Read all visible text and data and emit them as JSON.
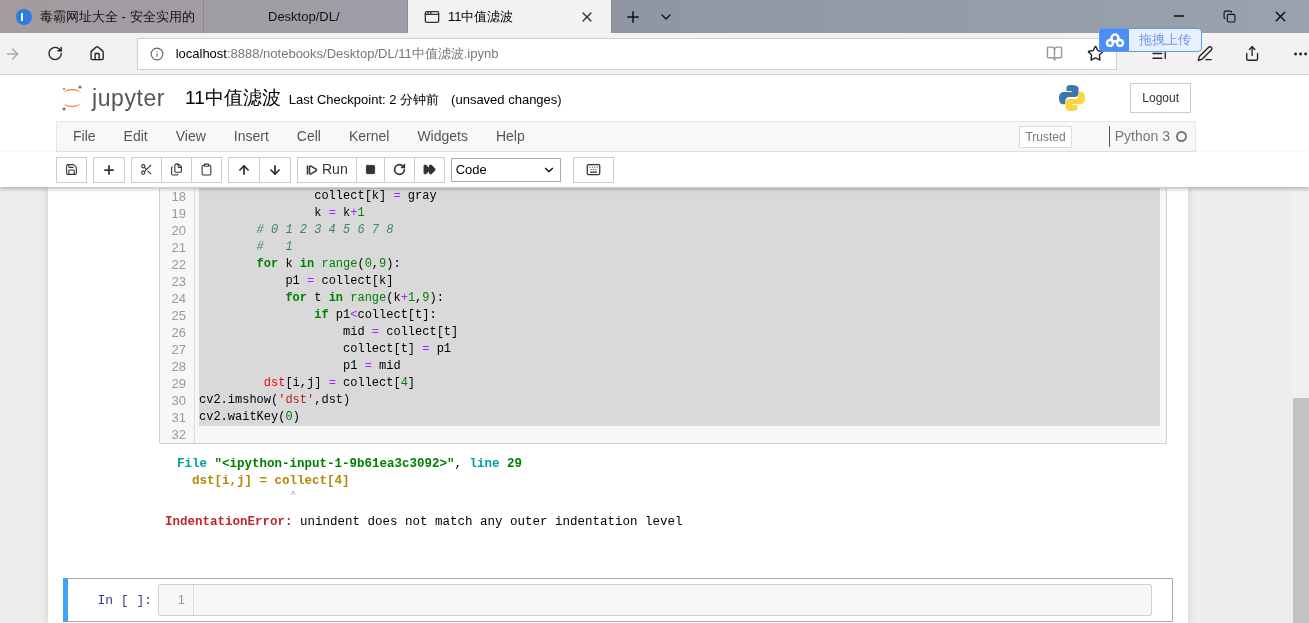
{
  "browser": {
    "tabs": [
      {
        "title": "毒霸网址大全 - 安全实用的",
        "kind": "site",
        "selected": false
      },
      {
        "title": "Desktop/DL/",
        "kind": "blank",
        "selected": false
      },
      {
        "title": "11中值滤波",
        "kind": "page",
        "selected": true
      }
    ],
    "address": {
      "host": "localhost",
      "path": ":8888/notebooks/Desktop/DL/11中值滤波.ipynb"
    },
    "upload_popup": "拖拽上传"
  },
  "header": {
    "logo": "jupyter",
    "notebook_name": "11中值滤波",
    "checkpoint": "Last Checkpoint: 2 分钟前",
    "status": "(unsaved changes)",
    "logout": "Logout"
  },
  "menu": [
    "File",
    "Edit",
    "View",
    "Insert",
    "Cell",
    "Kernel",
    "Widgets",
    "Help"
  ],
  "trusted": "Trusted",
  "kernel": {
    "name": "Python 3",
    "busy": false
  },
  "toolbar": {
    "run": "Run",
    "cell_type": "Code"
  },
  "cells": [
    {
      "selected": false,
      "lines": [
        {
          "n": "18",
          "tokens": [
            {
              "kind": "plain",
              "t": "                collect[k] "
            },
            {
              "kind": "op",
              "t": "="
            },
            {
              "kind": "plain",
              "t": " gray"
            }
          ]
        },
        {
          "n": "19",
          "tokens": [
            {
              "kind": "plain",
              "t": "                k "
            },
            {
              "kind": "op",
              "t": "="
            },
            {
              "kind": "plain",
              "t": " k"
            },
            {
              "kind": "op",
              "t": "+"
            },
            {
              "kind": "num",
              "t": "1"
            }
          ]
        },
        {
          "n": "20",
          "tokens": [
            {
              "kind": "comment",
              "t": "        # 0 1 2 3 4 5 6 7 8"
            }
          ]
        },
        {
          "n": "21",
          "tokens": [
            {
              "kind": "comment",
              "t": "        #   1"
            }
          ]
        },
        {
          "n": "22",
          "tokens": [
            {
              "kind": "kw",
              "t": "        for"
            },
            {
              "kind": "plain",
              "t": " k "
            },
            {
              "kind": "kw",
              "t": "in"
            },
            {
              "kind": "builtin",
              "t": " range"
            },
            {
              "kind": "plain",
              "t": "("
            },
            {
              "kind": "num",
              "t": "0"
            },
            {
              "kind": "plain",
              "t": ","
            },
            {
              "kind": "num",
              "t": "9"
            },
            {
              "kind": "plain",
              "t": "):"
            }
          ]
        },
        {
          "n": "23",
          "tokens": [
            {
              "kind": "plain",
              "t": "            p1 "
            },
            {
              "kind": "op",
              "t": "="
            },
            {
              "kind": "plain",
              "t": " collect[k]"
            }
          ]
        },
        {
          "n": "24",
          "tokens": [
            {
              "kind": "kw",
              "t": "            for"
            },
            {
              "kind": "plain",
              "t": " t "
            },
            {
              "kind": "kw",
              "t": "in"
            },
            {
              "kind": "builtin",
              "t": " range"
            },
            {
              "kind": "plain",
              "t": "(k"
            },
            {
              "kind": "op",
              "t": "+"
            },
            {
              "kind": "num",
              "t": "1"
            },
            {
              "kind": "plain",
              "t": ","
            },
            {
              "kind": "num",
              "t": "9"
            },
            {
              "kind": "plain",
              "t": "):"
            }
          ]
        },
        {
          "n": "25",
          "tokens": [
            {
              "kind": "kw",
              "t": "                if"
            },
            {
              "kind": "plain",
              "t": " p1"
            },
            {
              "kind": "op",
              "t": "<"
            },
            {
              "kind": "plain",
              "t": "collect[t]:"
            }
          ]
        },
        {
          "n": "26",
          "tokens": [
            {
              "kind": "plain",
              "t": "                    mid "
            },
            {
              "kind": "op",
              "t": "="
            },
            {
              "kind": "plain",
              "t": " collect[t]"
            }
          ]
        },
        {
          "n": "27",
          "tokens": [
            {
              "kind": "plain",
              "t": "                    collect[t] "
            },
            {
              "kind": "op",
              "t": "="
            },
            {
              "kind": "plain",
              "t": " p1"
            }
          ]
        },
        {
          "n": "28",
          "tokens": [
            {
              "kind": "plain",
              "t": "                    p1 "
            },
            {
              "kind": "op",
              "t": "="
            },
            {
              "kind": "plain",
              "t": " mid"
            }
          ]
        },
        {
          "n": "29",
          "tokens": [
            {
              "kind": "error",
              "t": "         dst"
            },
            {
              "kind": "plain",
              "t": "[i,j] "
            },
            {
              "kind": "op",
              "t": "="
            },
            {
              "kind": "plain",
              "t": " collect["
            },
            {
              "kind": "num",
              "t": "4"
            },
            {
              "kind": "plain",
              "t": "]"
            }
          ]
        },
        {
          "n": "30",
          "tokens": [
            {
              "kind": "plain",
              "t": "cv2.imshow("
            },
            {
              "kind": "string",
              "t": "'dst'"
            },
            {
              "kind": "plain",
              "t": ",dst)"
            }
          ]
        },
        {
          "n": "31",
          "tokens": [
            {
              "kind": "plain",
              "t": "cv2.waitKey("
            },
            {
              "kind": "num",
              "t": "0"
            },
            {
              "kind": "plain",
              "t": ")"
            }
          ]
        },
        {
          "n": "32"
        }
      ],
      "output": [
        {
          "kind": "location",
          "tokens": [
            {
              "kind": "teal",
              "t": "File "
            },
            {
              "kind": "green",
              "t": "\"<ipython-input-1-9b61ea3c3092>\""
            },
            {
              "kind": "plain",
              "t": ", "
            },
            {
              "kind": "teal",
              "t": "line "
            },
            {
              "kind": "green",
              "t": "29"
            }
          ]
        },
        {
          "kind": "source",
          "tokens": [
            {
              "kind": "gold",
              "t": "  dst[i,j] = collect[4]"
            }
          ]
        },
        {
          "kind": "caret",
          "tokens": [
            {
              "kind": "caret",
              "t": "                     ^"
            }
          ]
        },
        {
          "kind": "error",
          "tokens": [
            {
              "kind": "red",
              "t": "IndentationError:"
            },
            {
              "kind": "plain",
              "t": " unindent does not match any outer indentation level"
            }
          ]
        }
      ]
    },
    {
      "selected": true,
      "prompt": "In [ ]:",
      "lines": [
        {
          "n": "1"
        }
      ]
    }
  ]
}
